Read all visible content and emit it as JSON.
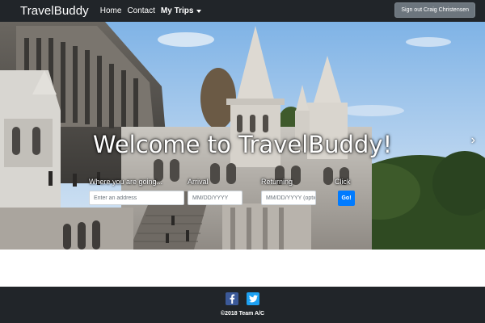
{
  "navbar": {
    "brand": "TravelBuddy",
    "links": [
      {
        "label": "Home"
      },
      {
        "label": "Contact"
      },
      {
        "label": "My Trips"
      }
    ],
    "signout_label": "Sign out Craig Christensen"
  },
  "hero": {
    "title": "Welcome to TravelBuddy!",
    "next_icon": "chevron-right-icon"
  },
  "search_form": {
    "destination": {
      "label": "Where you are going...",
      "placeholder": "Enter an address",
      "value": ""
    },
    "arrival": {
      "label": "Arrival",
      "placeholder": "MM/DD/YYYY",
      "value": ""
    },
    "returning": {
      "label": "Returning",
      "placeholder": "MM/DD/YYYY (optional)",
      "value": ""
    },
    "submit": {
      "label": "Click",
      "button": "Go!"
    }
  },
  "footer": {
    "social": [
      {
        "icon": "facebook-icon",
        "color": "#3b5998"
      },
      {
        "icon": "twitter-icon",
        "color": "#1da1f2"
      }
    ],
    "copyright": "©2018 Team A/C"
  },
  "colors": {
    "navbar_bg": "#212529",
    "primary": "#007bff",
    "secondary": "#6c757d"
  }
}
